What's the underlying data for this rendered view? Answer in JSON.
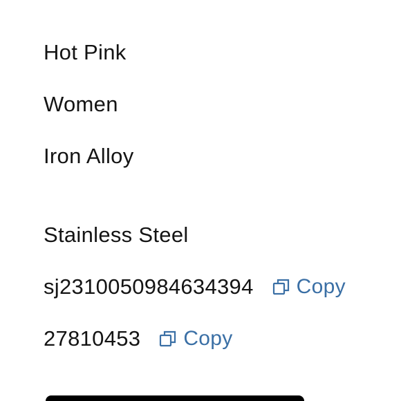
{
  "colors": {
    "accent": "#3a6fa5",
    "text": "#141414"
  },
  "details": {
    "color": "Hot Pink",
    "gender": "Women",
    "material": "Iron Alloy",
    "metal": "Stainless Steel",
    "sku": "sj2310050984634394",
    "goods_id": "27810453"
  },
  "copy": {
    "label": "Copy",
    "icon": "copy-icon"
  }
}
